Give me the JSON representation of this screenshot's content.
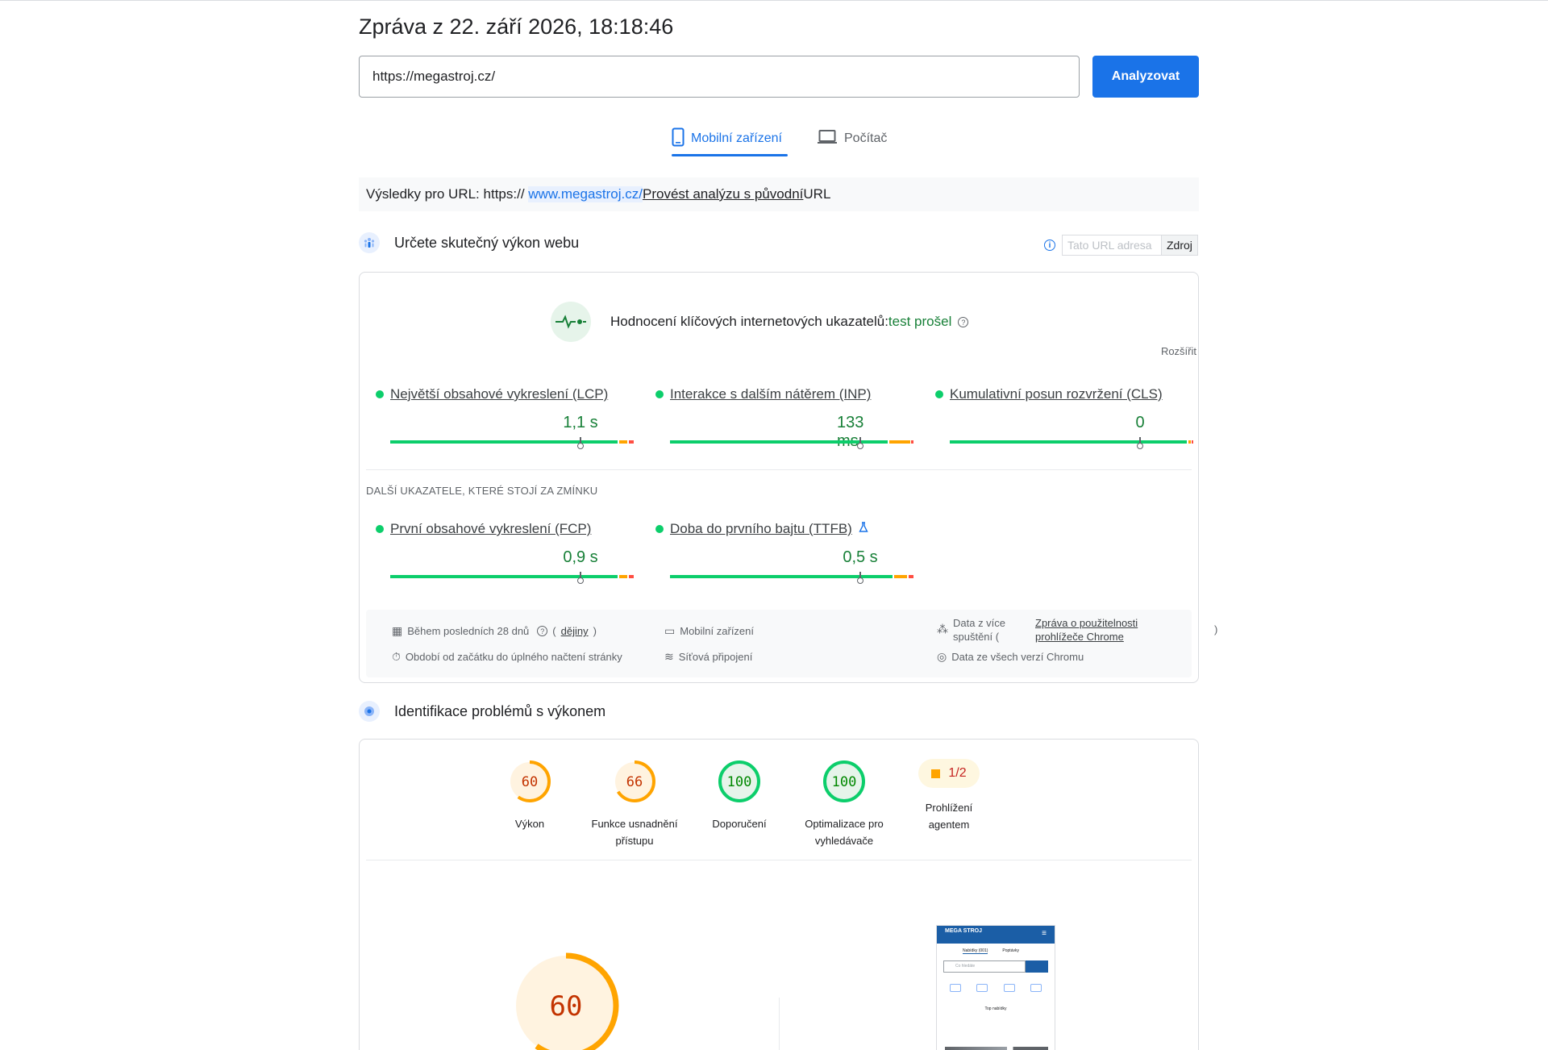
{
  "report": {
    "title": "Zpráva z 22. září 2026, 18:18:46",
    "url_value": "https://megastroj.cz/",
    "analyze_label": "Analyzovat"
  },
  "tabs": [
    {
      "label": "Mobilní zařízení",
      "active": true
    },
    {
      "label": "Počítač",
      "active": false
    }
  ],
  "results": {
    "prefix": "Výsledky pro URL:",
    "scheme": "https://",
    "link": "www.megastroj.cz/",
    "action": " Provést analýzu s původní ",
    "suffix": "URL"
  },
  "field_section": {
    "title": "Určete skutečný výkon webu",
    "source_placeholder": "Tato URL adresa",
    "source_label": "Zdroj"
  },
  "cwv": {
    "label": "Hodnocení klíčových internetových ukazatelů:",
    "status": "test prošel",
    "expand": "Rozšířit",
    "metrics": [
      {
        "name": "Největší obsahové vykreslení (LCP)",
        "value": "1,1 s",
        "marker": 0.75
      },
      {
        "name": "Interakce s dalším nátěrem (INP)",
        "value": "133 ms",
        "marker": 0.75
      },
      {
        "name": "Kumulativní posun rozvržení (CLS)",
        "value": "0",
        "marker": 0.75
      }
    ],
    "other_heading": "DALŠÍ UKAZATELE, KTERÉ STOJÍ ZA ZMÍNKU",
    "other_metrics": [
      {
        "name": "První obsahové vykreslení (FCP)",
        "value": "0,9 s",
        "marker": 0.75
      },
      {
        "name": "Doba do prvního bajtu (TTFB)",
        "value": "0,5 s",
        "marker": 0.75
      }
    ],
    "info": {
      "period": "Během posledních 28 dnů",
      "history": "dějiny",
      "duration": "Období od začátku do úplného načtení stránky",
      "device": "Mobilní zařízení",
      "network": "Síťová připojení",
      "samples_prefix": "Data z více spuštění (",
      "samples_link": "Zpráva o použitelnosti prohlížeče Chrome",
      "samples_suffix": ")",
      "versions": "Data ze všech verzí Chromu"
    }
  },
  "lab_section": {
    "title": "Identifikace problémů s výkonem",
    "gauges": [
      {
        "label": "Výkon",
        "score": "60",
        "color": "#ffa400",
        "fraction": 0.6
      },
      {
        "label": "Funkce usnadnění přístupu",
        "score": "66",
        "color": "#ffa400",
        "fraction": 0.66
      },
      {
        "label": "Doporučení",
        "score": "100",
        "color": "#0cce6b",
        "fraction": 1.0
      },
      {
        "label": "Optimalizace pro vyhledávače",
        "score": "100",
        "color": "#0cce6b",
        "fraction": 1.0
      }
    ],
    "agent": {
      "label": "Prohlížení agentem",
      "score": "1/2"
    },
    "big_score": "60"
  },
  "preview": {
    "brand": "MEGA STROJ",
    "tab1": "Nabídky (001)",
    "tab2": "Poptávky",
    "search": "Co hledáte",
    "section": "Top nabídky"
  },
  "colors": {
    "accent": "#1a73e8",
    "pass": "#0cce6b",
    "average": "#ffa400",
    "fail": "#ff4e42"
  }
}
